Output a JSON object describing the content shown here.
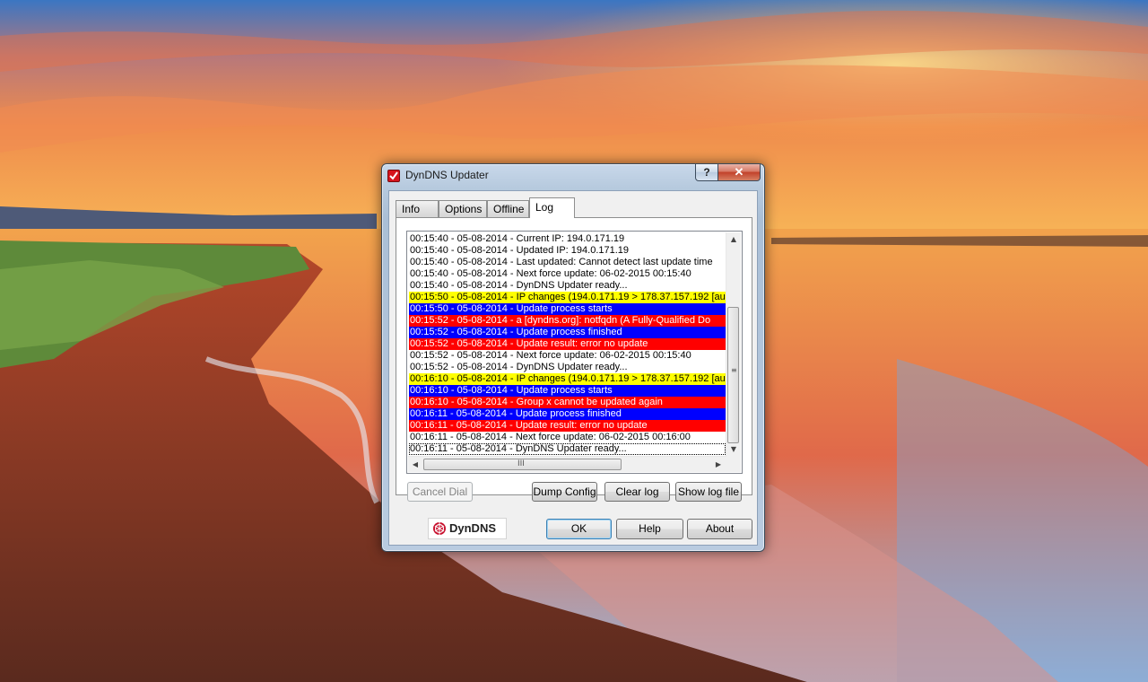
{
  "window": {
    "title": "DynDNS Updater",
    "help_caption": "?",
    "close_caption": "✕"
  },
  "tabs": [
    {
      "label": "Info",
      "active": false
    },
    {
      "label": "Options",
      "active": false
    },
    {
      "label": "Offline",
      "active": false
    },
    {
      "label": "Log",
      "active": true
    }
  ],
  "log": {
    "colors": {
      "normal": "#ffffff",
      "yellow": "#ffff00",
      "blue": "#0000ff",
      "red": "#ff0000"
    },
    "lines": [
      {
        "text": "00:15:40 - 05-08-2014 - Current IP: 194.0.171.19",
        "style": "normal"
      },
      {
        "text": "00:15:40 - 05-08-2014 - Updated IP: 194.0.171.19",
        "style": "normal"
      },
      {
        "text": "00:15:40 - 05-08-2014 - Last updated: Cannot detect last update time",
        "style": "normal"
      },
      {
        "text": "00:15:40 - 05-08-2014 - Next force update: 06-02-2015 00:15:40",
        "style": "normal"
      },
      {
        "text": "00:15:40 - 05-08-2014 - DynDNS Updater ready...",
        "style": "normal"
      },
      {
        "text": "00:15:50 - 05-08-2014 - IP changes (194.0.171.19 > 178.37.157.192 [au",
        "style": "yellow"
      },
      {
        "text": "00:15:50 - 05-08-2014 - Update process starts",
        "style": "blue"
      },
      {
        "text": "00:15:52 - 05-08-2014 - a [dyndns.org]: notfqdn (A Fully-Qualified Do",
        "style": "red"
      },
      {
        "text": "00:15:52 - 05-08-2014 - Update process finished",
        "style": "blue"
      },
      {
        "text": "00:15:52 - 05-08-2014 - Update result: error no update",
        "style": "red"
      },
      {
        "text": "00:15:52 - 05-08-2014 - Next force update: 06-02-2015 00:15:40",
        "style": "normal"
      },
      {
        "text": "00:15:52 - 05-08-2014 - DynDNS Updater ready...",
        "style": "normal"
      },
      {
        "text": "00:16:10 - 05-08-2014 - IP changes (194.0.171.19 > 178.37.157.192 [au",
        "style": "yellow"
      },
      {
        "text": "00:16:10 - 05-08-2014 - Update process starts",
        "style": "blue"
      },
      {
        "text": "00:16:10 - 05-08-2014 - Group x cannot be updated again",
        "style": "red"
      },
      {
        "text": "00:16:11 - 05-08-2014 - Update process finished",
        "style": "blue"
      },
      {
        "text": "00:16:11 - 05-08-2014 - Update result: error no update",
        "style": "red"
      },
      {
        "text": "00:16:11 - 05-08-2014 - Next force update: 06-02-2015 00:16:00",
        "style": "normal"
      },
      {
        "text": "00:16:11 - 05-08-2014 - DynDNS Updater ready...",
        "style": "normal",
        "focused": true
      }
    ]
  },
  "buttons": {
    "cancel_dial": "Cancel Dial",
    "dump_config": "Dump Config",
    "clear_log": "Clear log",
    "show_log_file": "Show log file",
    "ok": "OK",
    "help": "Help",
    "about": "About"
  },
  "logo": {
    "text": "DynDNS"
  },
  "scrollbar_glyphs": {
    "up": "▲",
    "down": "▼",
    "left": "◀",
    "right": "▶",
    "v_grip": "≡",
    "h_grip": "III"
  }
}
